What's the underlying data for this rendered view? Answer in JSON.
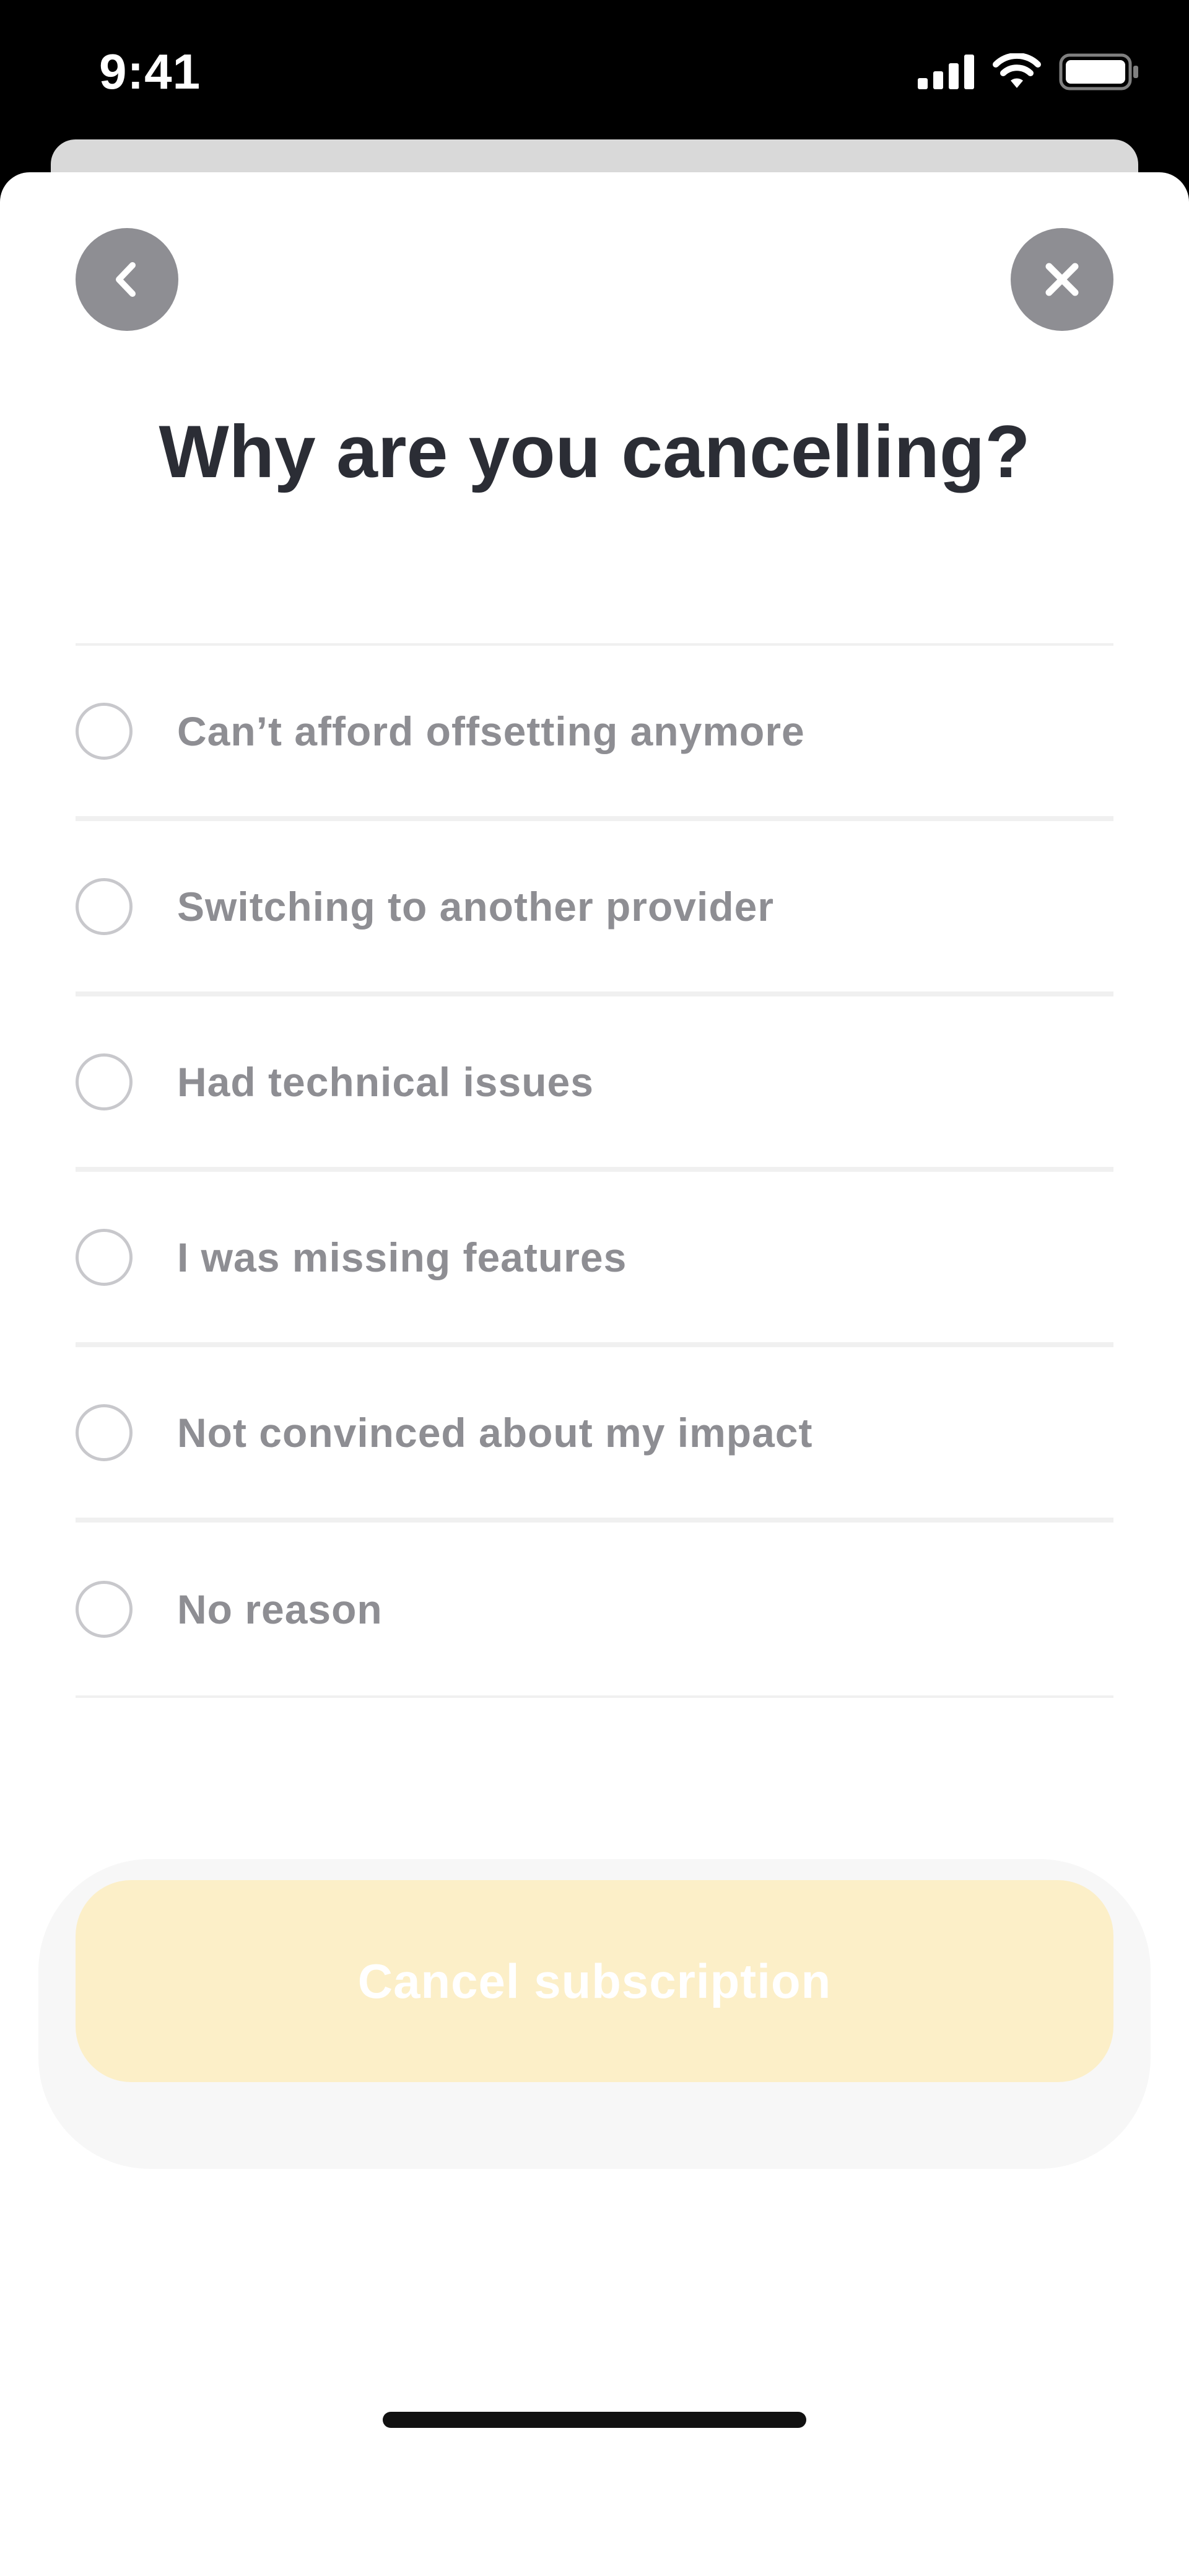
{
  "status_bar": {
    "time": "9:41",
    "icons": [
      "cellular-signal-icon",
      "wifi-icon",
      "battery-icon"
    ]
  },
  "header": {
    "back_icon": "chevron-left-icon",
    "close_icon": "close-icon",
    "title": "Why are you cancelling?"
  },
  "reasons": [
    {
      "label": "Can’t afford offsetting anymore",
      "selected": false
    },
    {
      "label": "Switching to another provider",
      "selected": false
    },
    {
      "label": "Had technical issues",
      "selected": false
    },
    {
      "label": "I was missing features",
      "selected": false
    },
    {
      "label": "Not convinced about my impact",
      "selected": false
    },
    {
      "label": "No reason",
      "selected": false
    }
  ],
  "actions": {
    "cancel_label": "Cancel subscription",
    "cancel_enabled": false
  },
  "colors": {
    "title": "#2b2d35",
    "option_text": "#8e8e93",
    "icon_button": "#8e8e93",
    "cancel_button_disabled": "#fcefc8"
  }
}
